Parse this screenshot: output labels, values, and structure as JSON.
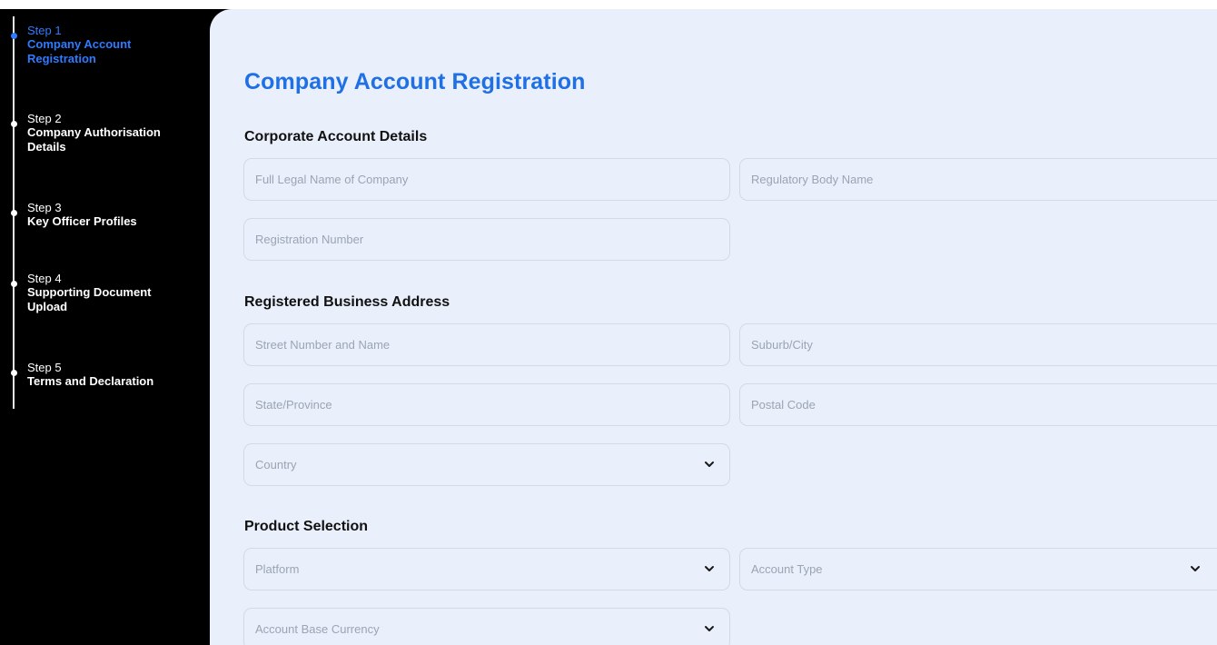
{
  "stepper": {
    "steps": [
      {
        "step": "Step 1",
        "title": "Company Account\nRegistration",
        "active": true
      },
      {
        "step": "Step 2",
        "title": "Company Authorisation\nDetails",
        "active": false
      },
      {
        "step": "Step 3",
        "title": "Key Officer Profiles",
        "active": false
      },
      {
        "step": "Step 4",
        "title": "Supporting Document\nUpload",
        "active": false
      },
      {
        "step": "Step 5",
        "title": "Terms and Declaration",
        "active": false
      }
    ]
  },
  "page": {
    "title": "Company Account Registration"
  },
  "sections": {
    "corporate": {
      "title": "Corporate Account Details",
      "full_legal_name": {
        "placeholder": "Full Legal Name of Company"
      },
      "regulatory_body": {
        "placeholder": "Regulatory Body Name"
      },
      "registration_number": {
        "placeholder": "Registration Number"
      }
    },
    "address": {
      "title": "Registered Business Address",
      "street": {
        "placeholder": "Street Number and Name"
      },
      "suburb": {
        "placeholder": "Suburb/City"
      },
      "state": {
        "placeholder": "State/Province"
      },
      "postal": {
        "placeholder": "Postal Code"
      },
      "country": {
        "placeholder": "Country"
      }
    },
    "product": {
      "title": "Product Selection",
      "platform": {
        "placeholder": "Platform"
      },
      "account_type": {
        "placeholder": "Account Type"
      },
      "base_currency": {
        "placeholder": "Account Base Currency"
      }
    }
  },
  "colors": {
    "accent": "#2f7bff",
    "title": "#1f6fe5",
    "panel": "#eaf0fb",
    "sidebar": "#000000"
  },
  "icons": {
    "dropdown": "chevron-down-icon"
  }
}
